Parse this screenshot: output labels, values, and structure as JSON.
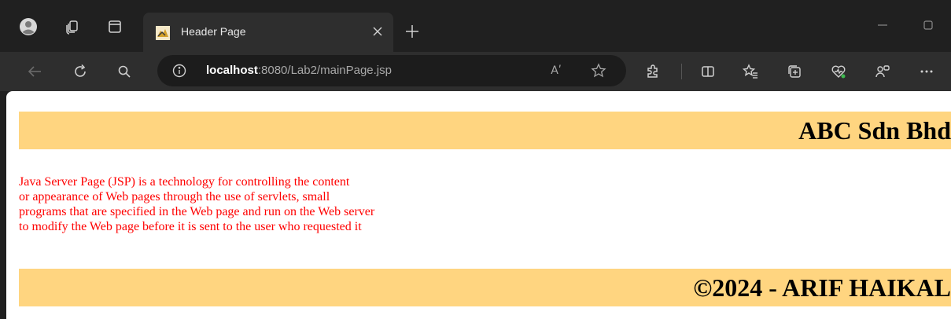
{
  "browser": {
    "tab": {
      "title": "Header Page",
      "favicon": "tomcat-favicon-icon"
    },
    "toolbar": {
      "url_host": "localhost",
      "url_rest": ":8080/Lab2/mainPage.jsp",
      "read_aloud_glyph": "Aʹ"
    },
    "colors": {
      "frame": "#202020",
      "toolbar": "#2e2e2e",
      "addressbar": "#1c1c1c"
    }
  },
  "page": {
    "header_title": "ABC Sdn Bhd",
    "content_lines": [
      "Java Server Page (JSP) is a technology for controlling the content",
      "or appearance of Web pages through the use of servlets, small",
      "programs that are specified in the Web page and run on the Web server",
      "to modify the Web page before it is sent to the user who requested it"
    ],
    "footer_title": "©2024 - ARIF HAIKAL",
    "colors": {
      "band": "#ffd580",
      "content_text": "#ff0000",
      "title_text": "#000000"
    }
  }
}
